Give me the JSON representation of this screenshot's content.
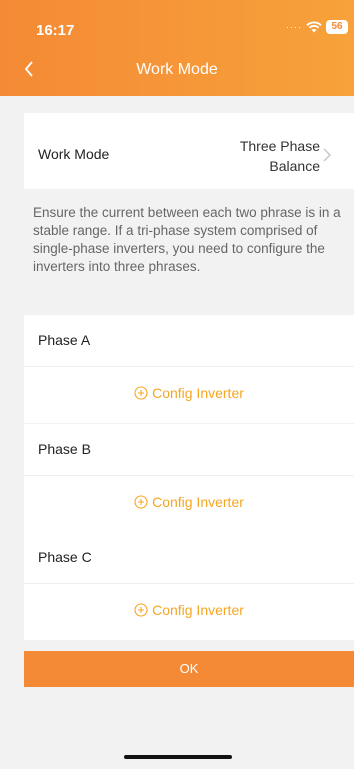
{
  "status": {
    "time": "16:17",
    "battery": "56"
  },
  "nav": {
    "title": "Work Mode"
  },
  "work_mode": {
    "label": "Work Mode",
    "value_line1": "Three Phase",
    "value_line2": "Balance"
  },
  "description": "Ensure the current between each two phrase is in a stable range. If a tri-phase system comprised of single-phase inverters, you need to configure the inverters into three phrases.",
  "phases": [
    {
      "label": "Phase A",
      "action": "Config Inverter"
    },
    {
      "label": "Phase B",
      "action": "Config Inverter"
    },
    {
      "label": "Phase C",
      "action": "Config Inverter"
    }
  ],
  "ok_button": "OK",
  "colors": {
    "accent": "#f48a36",
    "link": "#f5a623",
    "background": "#f2f2f2"
  }
}
